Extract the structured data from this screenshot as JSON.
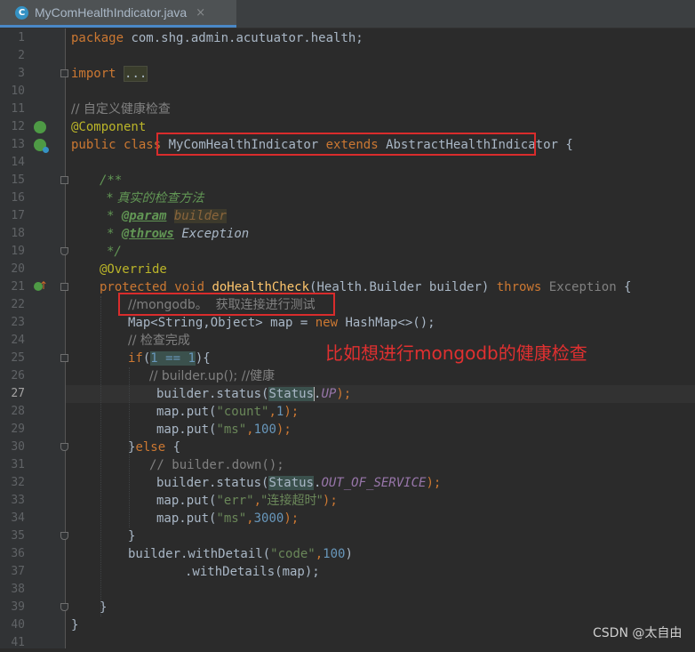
{
  "tab": {
    "icon_letter": "C",
    "title": "MyComHealthIndicator.java",
    "close": "×"
  },
  "lines": [
    {
      "num": "1"
    },
    {
      "num": "2"
    },
    {
      "num": "3"
    },
    {
      "num": "10"
    },
    {
      "num": "11"
    },
    {
      "num": "12"
    },
    {
      "num": "13"
    },
    {
      "num": "14"
    },
    {
      "num": "15"
    },
    {
      "num": "16"
    },
    {
      "num": "17"
    },
    {
      "num": "18"
    },
    {
      "num": "19"
    },
    {
      "num": "20"
    },
    {
      "num": "21"
    },
    {
      "num": "22"
    },
    {
      "num": "23"
    },
    {
      "num": "24"
    },
    {
      "num": "25"
    },
    {
      "num": "26"
    },
    {
      "num": "27"
    },
    {
      "num": "28"
    },
    {
      "num": "29"
    },
    {
      "num": "30"
    },
    {
      "num": "31"
    },
    {
      "num": "32"
    },
    {
      "num": "33"
    },
    {
      "num": "34"
    },
    {
      "num": "35"
    },
    {
      "num": "36"
    },
    {
      "num": "37"
    },
    {
      "num": "38"
    },
    {
      "num": "39"
    },
    {
      "num": "40"
    },
    {
      "num": "41"
    }
  ],
  "code": {
    "l1_kw": "package",
    "l1_rest": " com.shg.admin.acutuator.health;",
    "l3_kw": "import",
    "l3_folded": "...",
    "l11": "// 自定义健康检查",
    "l12": "@Component",
    "l13_kw1": "public",
    "l13_kw2": "class",
    "l13_name": "MyComHealthIndicator",
    "l13_ext": "extends",
    "l13_super": "AbstractHealthIndicator",
    "l13_brace": "{",
    "l15": "/**",
    "l16": "* 真实的检查方法",
    "l17_star": "* ",
    "l17_tag": "@param",
    "l17_param": "builder",
    "l18_star": "* ",
    "l18_tag": "@throws",
    "l18_ex": "Exception",
    "l19": "*/",
    "l20": "@Override",
    "l21_kw1": "protected",
    "l21_kw2": "void",
    "l21_fn": "doHealthCheck",
    "l21_args": "(Health.Builder builder) ",
    "l21_throws": "throws",
    "l21_ex": "Exception",
    "l21_brace": " {",
    "l22": "//mongodb。  获取连接进行测试",
    "l23_a": "Map<String,Object> map = ",
    "l23_new": "new",
    "l23_b": " HashMap<>();",
    "l24": "// 检查完成",
    "l25_if": "if",
    "l25_open": "(",
    "l25_cond": "1 == 1",
    "l25_close": "){",
    "l26": "// builder.up(); //健康",
    "l27_a": "builder.status(",
    "l27_status": "Status",
    "l27_dot": ".",
    "l27_const": "UP",
    "l27_end": ");",
    "l28_a": "map.put(",
    "l28_str": "\"count\"",
    "l28_comma": ",",
    "l28_num": "1",
    "l28_end": ");",
    "l29_a": "map.put(",
    "l29_str": "\"ms\"",
    "l29_comma": ",",
    "l29_num": "100",
    "l29_end": ");",
    "l30_a": "}",
    "l30_else": "else",
    "l30_b": " {",
    "l31": "// builder.down();",
    "l32_a": "builder.status(",
    "l32_status": "Status",
    "l32_dot": ".",
    "l32_const": "OUT_OF_SERVICE",
    "l32_end": ");",
    "l33_a": "map.put(",
    "l33_str": "\"err\"",
    "l33_comma": ",",
    "l33_str2": "\"连接超时\"",
    "l33_end": ");",
    "l34_a": "map.put(",
    "l34_str": "\"ms\"",
    "l34_comma": ",",
    "l34_num": "3000",
    "l34_end": ");",
    "l35": "}",
    "l36_a": "builder.withDetail(",
    "l36_str": "\"code\"",
    "l36_comma": ",",
    "l36_num": "100",
    "l36_end": ")",
    "l37": ".withDetails(map);",
    "l39": "}",
    "l40": "}"
  },
  "annotation": "比如想进行mongodb的健康检查",
  "watermark": "CSDN @太自由",
  "colors": {
    "highlight_box": "#d92c2c",
    "annotation_text": "#e03030",
    "keyword": "#cc7832",
    "string": "#6a8759",
    "number": "#6897bb"
  }
}
